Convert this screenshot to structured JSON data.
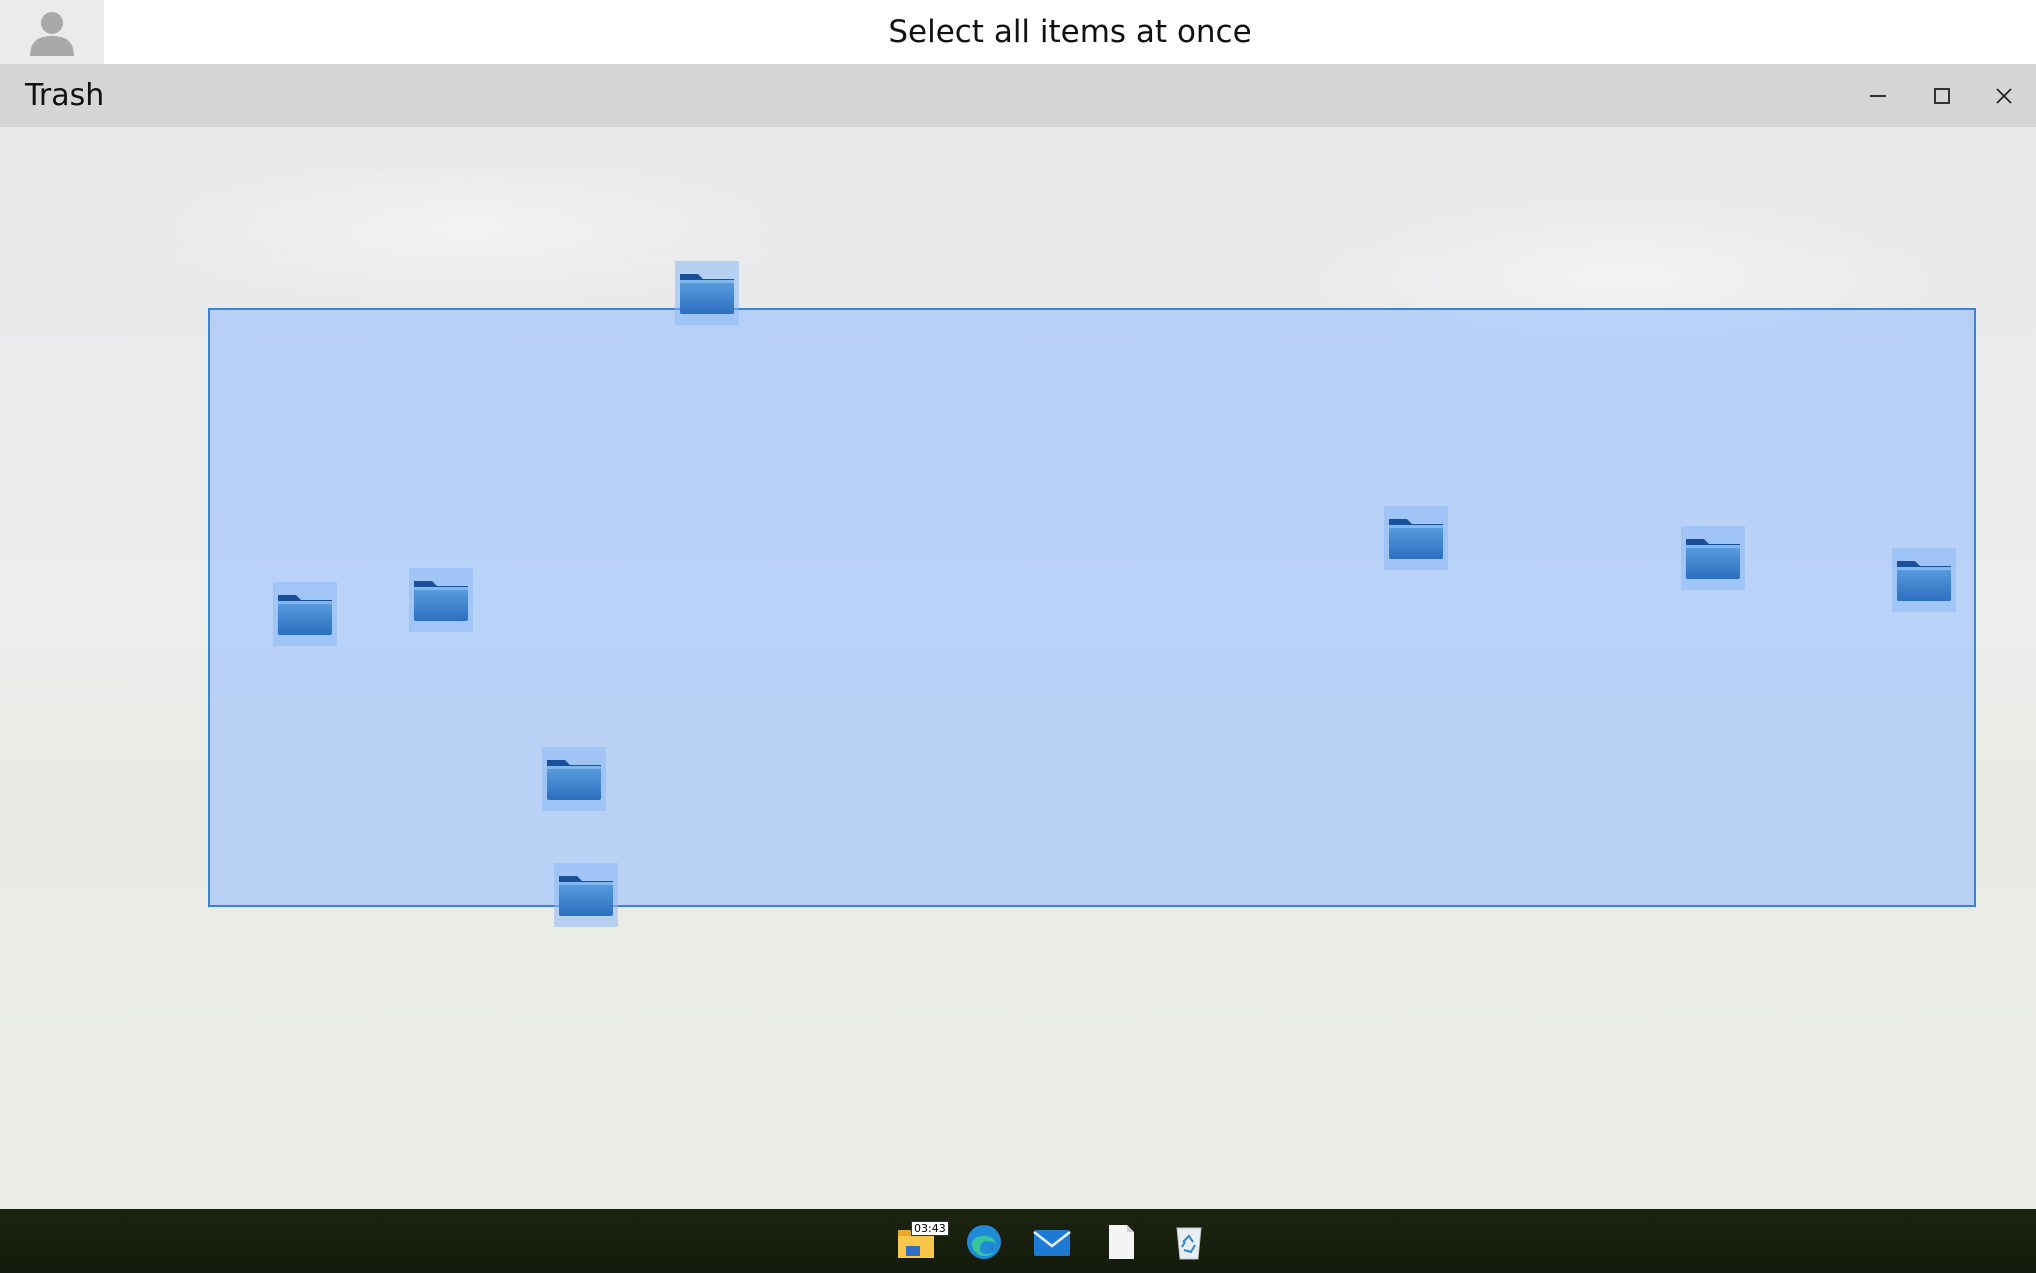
{
  "topbar": {
    "instruction": "Select all items at once",
    "avatar_icon": "user-avatar-icon"
  },
  "window": {
    "title": "Trash",
    "controls": [
      "minimize-icon",
      "maximize-icon",
      "close-icon"
    ]
  },
  "desktop": {
    "folders": [
      {
        "icon": "folder-icon",
        "selected": true
      },
      {
        "icon": "folder-icon",
        "selected": true
      },
      {
        "icon": "folder-icon",
        "selected": true
      },
      {
        "icon": "folder-icon",
        "selected": true
      },
      {
        "icon": "folder-icon",
        "selected": true
      },
      {
        "icon": "folder-icon",
        "selected": true
      },
      {
        "icon": "folder-icon",
        "selected": true
      },
      {
        "icon": "folder-icon",
        "selected": true
      }
    ],
    "selection_color": "#94beff"
  },
  "taskbar": {
    "clock": "03:43",
    "apps": [
      "file-explorer-icon",
      "edge-browser-icon",
      "mail-icon",
      "document-icon",
      "recycle-bin-icon"
    ]
  }
}
